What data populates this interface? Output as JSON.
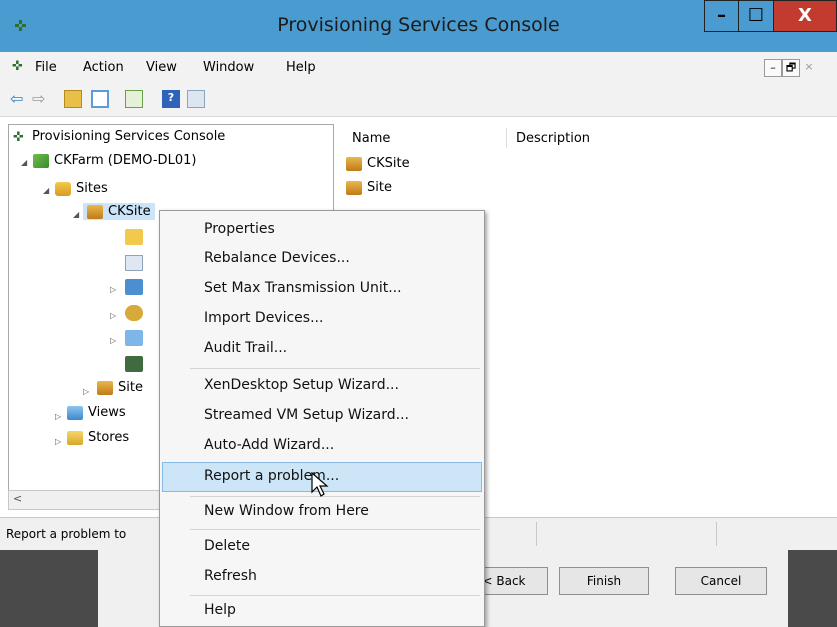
{
  "window": {
    "title": "Provisioning Services Console",
    "controls": {
      "minimize": "–",
      "maximize": "☐",
      "close": "X"
    }
  },
  "menubar": {
    "items": [
      "File",
      "Action",
      "View",
      "Window",
      "Help"
    ],
    "mdi": {
      "minimize": "–",
      "restore": "🗗",
      "close": "×"
    }
  },
  "tree": {
    "root": "Provisioning Services Console",
    "farm": "CKFarm (DEMO-DL01)",
    "sites": "Sites",
    "ck_site": "CKSite",
    "site": "Site",
    "views": "Views",
    "stores": "Stores"
  },
  "list": {
    "columns": {
      "name": "Name",
      "description": "Description"
    },
    "rows": [
      {
        "name": "CKSite"
      },
      {
        "name": "Site"
      }
    ]
  },
  "statusbar": {
    "text": "Report a problem to"
  },
  "wizard": {
    "back": "< Back",
    "finish": "Finish",
    "cancel": "Cancel"
  },
  "context_menu": {
    "items": [
      "Properties",
      "Rebalance Devices...",
      "Set Max Transmission Unit...",
      "Import Devices...",
      "Audit Trail...",
      "XenDesktop Setup Wizard...",
      "Streamed VM Setup Wizard...",
      "Auto-Add Wizard...",
      "Report a problem...",
      "New Window from Here",
      "Delete",
      "Refresh",
      "Help"
    ],
    "highlighted": "Report a problem..."
  },
  "colors": {
    "titlebar": "#4a9bd0",
    "close_button": "#c33a2e",
    "menu_highlight": "#cde6f7"
  }
}
